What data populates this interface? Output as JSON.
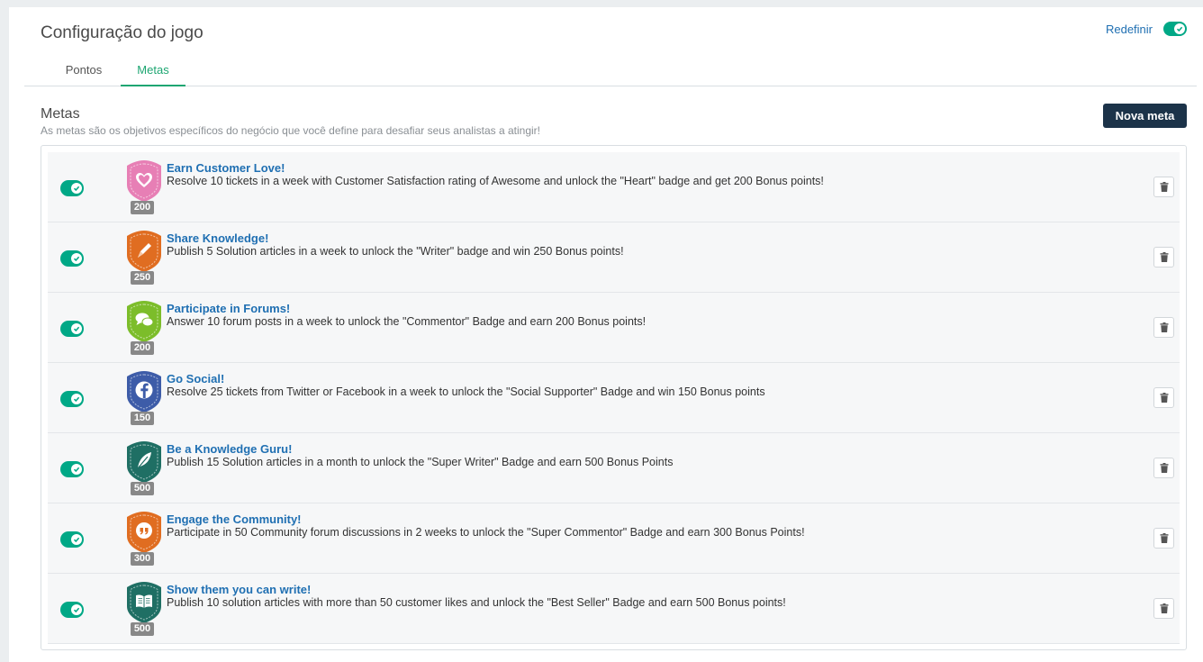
{
  "header": {
    "title": "Configuração do jogo",
    "reset_label": "Redefinir"
  },
  "tabs": [
    {
      "label": "Pontos"
    },
    {
      "label": "Metas"
    }
  ],
  "section": {
    "title": "Metas",
    "description": "As metas são os objetivos específicos do negócio que você define para desafiar seus analistas a atingir!",
    "new_button": "Nova meta"
  },
  "goals": [
    {
      "title": "Earn Customer Love!",
      "description": "Resolve 10 tickets in a week with Customer Satisfaction rating of Awesome and unlock the \"Heart\" badge and get 200 Bonus points!",
      "points": "200",
      "badge_color": "#e77fb5",
      "badge_icon": "heart-icon",
      "enabled": true
    },
    {
      "title": "Share Knowledge!",
      "description": "Publish 5 Solution articles in a week to unlock the \"Writer\" badge and win 250 Bonus points!",
      "points": "250",
      "badge_color": "#e06d21",
      "badge_icon": "pen-icon",
      "enabled": true
    },
    {
      "title": "Participate in Forums!",
      "description": "Answer 10 forum posts in a week to unlock the \"Commentor\" Badge and earn 200 Bonus points!",
      "points": "200",
      "badge_color": "#7cbd2a",
      "badge_icon": "chat-icon",
      "enabled": true
    },
    {
      "title": "Go Social!",
      "description": "Resolve 25 tickets from Twitter or Facebook in a week to unlock the \"Social Supporter\" Badge and win 150 Bonus points",
      "points": "150",
      "badge_color": "#3d5ca8",
      "badge_icon": "facebook-icon",
      "enabled": true
    },
    {
      "title": "Be a Knowledge Guru!",
      "description": "Publish 15 Solution articles in a month to unlock the \"Super Writer\" Badge and earn 500 Bonus Points",
      "points": "500",
      "badge_color": "#1f6f64",
      "badge_icon": "feather-icon",
      "enabled": true
    },
    {
      "title": "Engage the Community!",
      "description": "Participate in 50 Community forum discussions in 2 weeks to unlock the \"Super Commentor\" Badge and earn 300 Bonus Points!",
      "points": "300",
      "badge_color": "#e06d21",
      "badge_icon": "quote-icon",
      "enabled": true
    },
    {
      "title": "Show them you can write!",
      "description": "Publish 10 solution articles with more than 50 customer likes and unlock the \"Best Seller\" Badge and earn 500 Bonus points!",
      "points": "500",
      "badge_color": "#1f6f64",
      "badge_icon": "book-icon",
      "enabled": true
    }
  ]
}
